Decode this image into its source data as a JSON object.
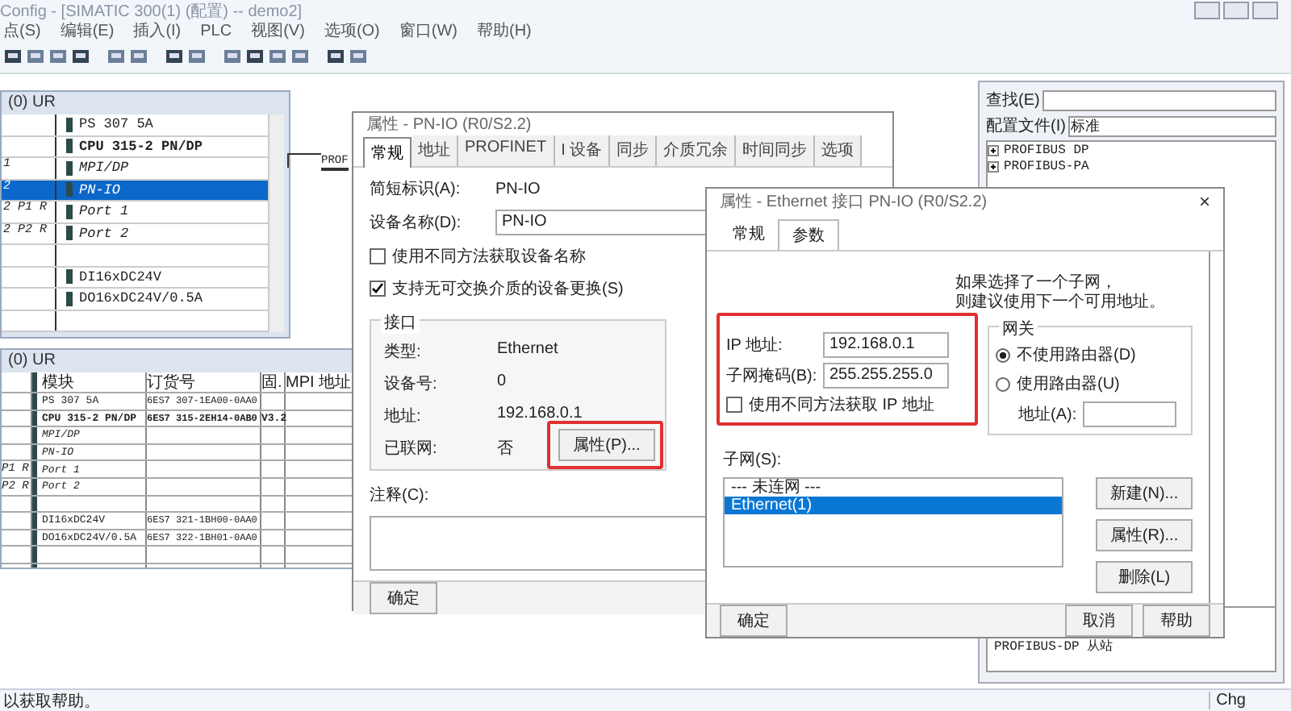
{
  "window": {
    "title": "Config - [SIMATIC 300(1) (配置) -- demo2]"
  },
  "menu": [
    "点(S)",
    "编辑(E)",
    "插入(I)",
    "PLC",
    "视图(V)",
    "选项(O)",
    "窗口(W)",
    "帮助(H)"
  ],
  "rack": {
    "title": "(0) UR",
    "rows": [
      {
        "module": "PS 307 5A",
        "kind": "module",
        "selected": false
      },
      {
        "module": "CPU 315-2 PN/DP",
        "kind": "cpu",
        "selected": false
      },
      {
        "slot": "1",
        "module": "MPI/DP",
        "kind": "sub",
        "selected": false
      },
      {
        "slot": "2",
        "module": "PN-IO",
        "kind": "sub",
        "selected": true
      },
      {
        "slot": "2 P1 R",
        "module": "Port 1",
        "kind": "sub",
        "selected": false
      },
      {
        "slot": "2 P2 R",
        "module": "Port 2",
        "kind": "sub",
        "selected": false
      },
      {
        "kind": "empty",
        "selected": false
      },
      {
        "module": "DI16xDC24V",
        "kind": "module",
        "selected": false
      },
      {
        "module": "DO16xDC24V/0.5A",
        "kind": "module",
        "selected": false
      },
      {
        "kind": "empty",
        "selected": false
      }
    ]
  },
  "network_label": "PROF",
  "table": {
    "title": "(0) UR",
    "columns": [
      "模块",
      "订货号",
      "固.",
      "MPI 地址"
    ],
    "rows": [
      {
        "module": "PS 307 5A",
        "order": "6ES7 307-1EA00-0AA0",
        "kind": "module"
      },
      {
        "module": "CPU 315-2 PN/DP",
        "order": "6ES7 315-2EH14-0AB0",
        "firmware": "V3.2",
        "kind": "cpu"
      },
      {
        "module": "MPI/DP",
        "kind": "sub"
      },
      {
        "module": "PN-IO",
        "kind": "sub"
      },
      {
        "slot": "P1 R",
        "module": "Port 1",
        "kind": "sub"
      },
      {
        "slot": "P2 R",
        "module": "Port 2",
        "kind": "sub"
      },
      {
        "kind": "empty"
      },
      {
        "module": "DI16xDC24V",
        "order": "6ES7 321-1BH00-0AA0",
        "kind": "module"
      },
      {
        "module": "DO16xDC24V/0.5A",
        "order": "6ES7 322-1BH01-0AA0",
        "kind": "module"
      },
      {
        "kind": "empty"
      },
      {
        "kind": "empty"
      },
      {
        "kind": "empty"
      },
      {
        "kind": "empty"
      },
      {
        "kind": "empty"
      }
    ]
  },
  "catalog": {
    "search_label": "查找(E)",
    "profile_label": "配置文件(I)",
    "profile_value": "标准",
    "tree": [
      {
        "label": "PROFIBUS DP",
        "expanded": false
      },
      {
        "label": "PROFIBUS-PA",
        "expanded": false
      }
    ],
    "info": "PROFIBUS-DP 从站"
  },
  "dialog1": {
    "title": "属性 - PN-IO (R0/S2.2)",
    "tabs": [
      {
        "label": "常规",
        "selected": true
      },
      {
        "label": "地址",
        "selected": false
      },
      {
        "label": "PROFINET",
        "selected": false
      },
      {
        "label": "I 设备",
        "selected": false
      },
      {
        "label": "同步",
        "selected": false
      },
      {
        "label": "介质冗余",
        "selected": false
      },
      {
        "label": "时间同步",
        "selected": false
      },
      {
        "label": "选项",
        "selected": false
      }
    ],
    "short_label": "简短标识(A):",
    "short_value": "PN-IO",
    "name_label": "设备名称(D):",
    "name_value": "PN-IO",
    "checks": [
      {
        "label": "使用不同方法获取设备名称",
        "checked": false
      },
      {
        "label": "支持无可交换介质的设备更换(S)",
        "checked": true
      }
    ],
    "group_title": "接口",
    "props": [
      {
        "label": "类型:",
        "value": "Ethernet"
      },
      {
        "label": "设备号:",
        "value": "0"
      },
      {
        "label": "地址:",
        "value": "192.168.0.1"
      },
      {
        "label": "已联网:",
        "value": "否"
      }
    ],
    "props_button": "属性(P)...",
    "comment_label": "注释(C):",
    "ok": "确定"
  },
  "dialog2": {
    "title": "属性 - Ethernet 接口 PN-IO (R0/S2.2)",
    "close": "×",
    "tabs": [
      {
        "label": "常规",
        "selected": false
      },
      {
        "label": "参数",
        "selected": true
      }
    ],
    "hint": [
      "如果选择了一个子网，",
      "则建议使用下一个可用地址。"
    ],
    "ip_label": "IP 地址:",
    "ip_value": "192.168.0.1",
    "mask_label": "子网掩码(B):",
    "mask_value": "255.255.255.0",
    "ip_check": {
      "label": "使用不同方法获取 IP 地址",
      "checked": false
    },
    "gateway_title": "网关",
    "radios": [
      {
        "label": "不使用路由器(D)",
        "selected": true
      },
      {
        "label": "使用路由器(U)",
        "selected": false
      }
    ],
    "gw_addr_label": "地址(A):",
    "subnet_label": "子网(S):",
    "subnets": [
      {
        "label": "--- 未连网 ---",
        "selected": false
      },
      {
        "label": "Ethernet(1)",
        "selected": true
      }
    ],
    "side_buttons": [
      "新建(N)...",
      "属性(R)...",
      "删除(L)"
    ],
    "ok": "确定",
    "cancel": "取消",
    "help": "帮助"
  },
  "status_bar": {
    "text": "以获取帮助。",
    "mode": "Chg"
  }
}
